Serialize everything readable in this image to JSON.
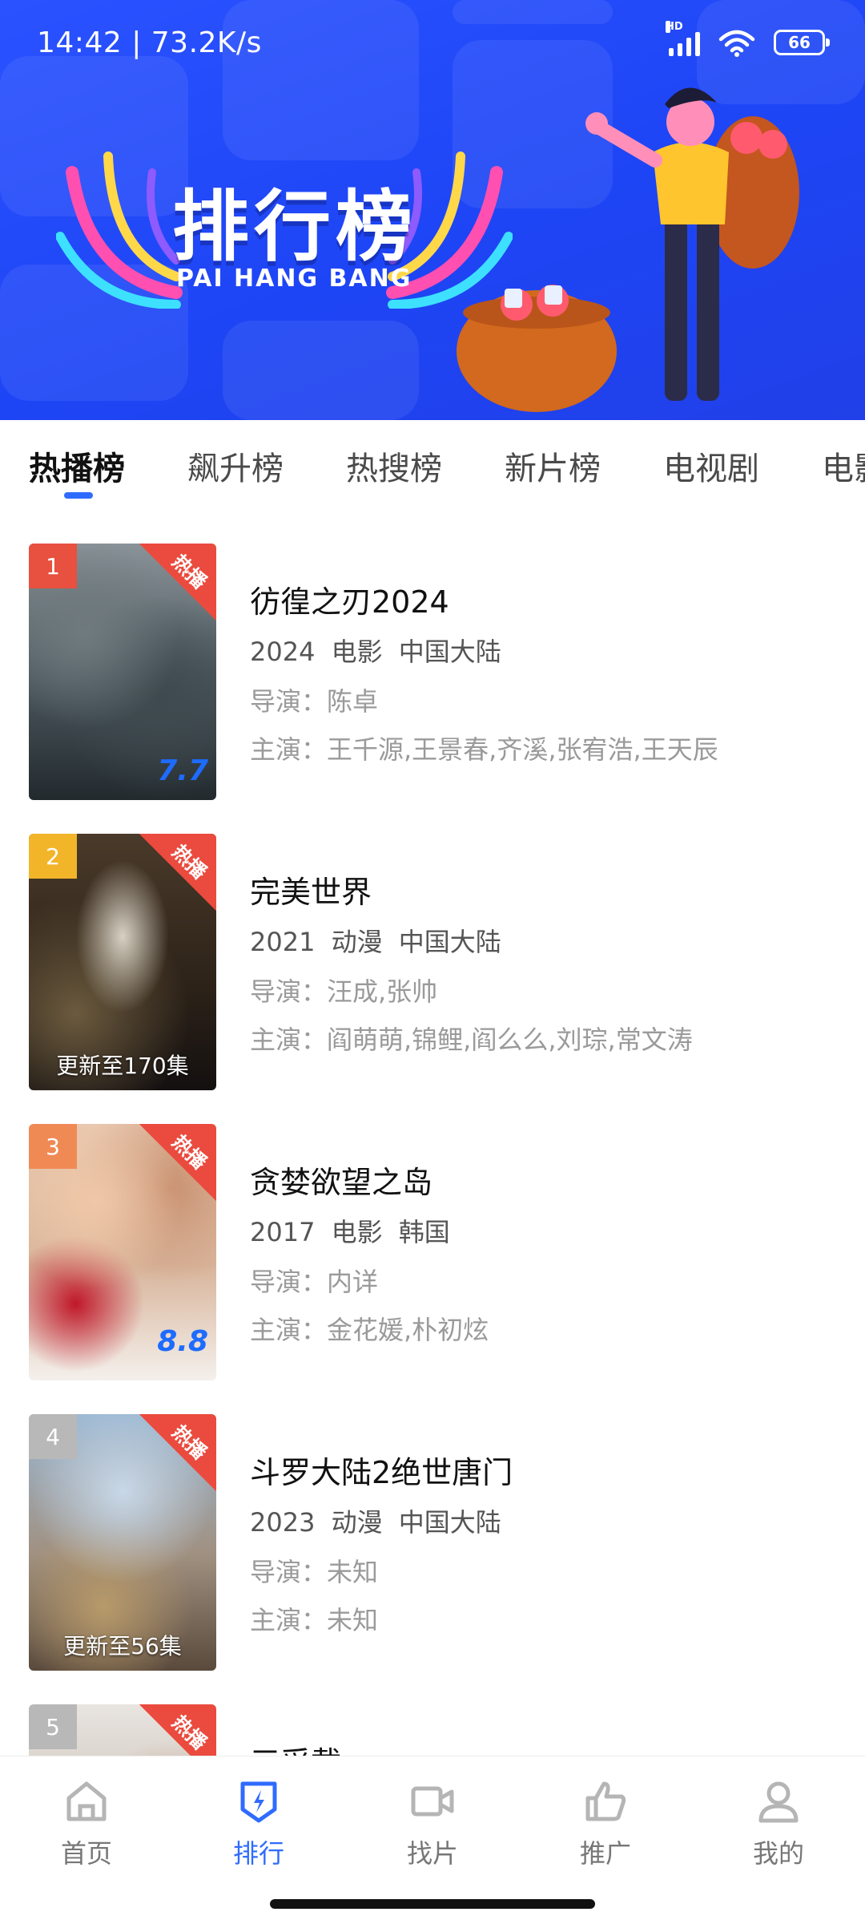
{
  "status_bar": {
    "time": "14:42 | 73.2K/s",
    "network_badge": "HD",
    "battery": "66",
    "icons": [
      "signal-icon",
      "wifi-icon",
      "battery-icon"
    ]
  },
  "banner": {
    "title": "排行榜",
    "subtitle": "PAI HANG BANG",
    "background": "#2348f8"
  },
  "tabs": [
    {
      "label": "热播榜",
      "active": true
    },
    {
      "label": "飙升榜",
      "active": false
    },
    {
      "label": "热搜榜",
      "active": false
    },
    {
      "label": "新片榜",
      "active": false
    },
    {
      "label": "电视剧",
      "active": false
    },
    {
      "label": "电影",
      "active": false
    }
  ],
  "hot_badge": "热播",
  "items": [
    {
      "rank": "1",
      "title": "彷徨之刃2024",
      "meta": "2024 电影 中国大陆",
      "director": "导演：陈卓",
      "cast": "主演：王千源,王景春,齐溪,张宥浩,王天辰",
      "score": "7.7",
      "update": "",
      "rank_color": "#e8503f"
    },
    {
      "rank": "2",
      "title": "完美世界",
      "meta": "2021 动漫 中国大陆",
      "director": "导演：汪成,张帅",
      "cast": "主演：阎萌萌,锦鲤,阎么么,刘琮,常文涛",
      "score": "",
      "update": "更新至170集",
      "rank_color": "#f2b52a"
    },
    {
      "rank": "3",
      "title": "贪婪欲望之岛",
      "meta": "2017 电影 韩国",
      "director": "导演：内详",
      "cast": "主演：金花媛,朴初炫",
      "score": "8.8",
      "update": "",
      "rank_color": "#f08a55"
    },
    {
      "rank": "4",
      "title": "斗罗大陆2绝世唐门",
      "meta": "2023 动漫 中国大陆",
      "director": "导演：未知",
      "cast": "主演：未知",
      "score": "",
      "update": "更新至56集",
      "rank_color": "#b8b8b8"
    },
    {
      "rank": "5",
      "title": "三采载",
      "meta": "",
      "director": "",
      "cast": "",
      "score": "",
      "update": "",
      "rank_color": "#b8b8b8"
    }
  ],
  "bottom_nav": [
    {
      "label": "首页",
      "icon": "home-icon",
      "active": false
    },
    {
      "label": "排行",
      "icon": "ranking-icon",
      "active": true
    },
    {
      "label": "找片",
      "icon": "video-camera-icon",
      "active": false
    },
    {
      "label": "推广",
      "icon": "thumbs-up-icon",
      "active": false
    },
    {
      "label": "我的",
      "icon": "user-icon",
      "active": false
    }
  ],
  "colors": {
    "accent": "#2f6bff",
    "hot_red": "#ea4b3e",
    "score_blue": "#1e6bff"
  }
}
